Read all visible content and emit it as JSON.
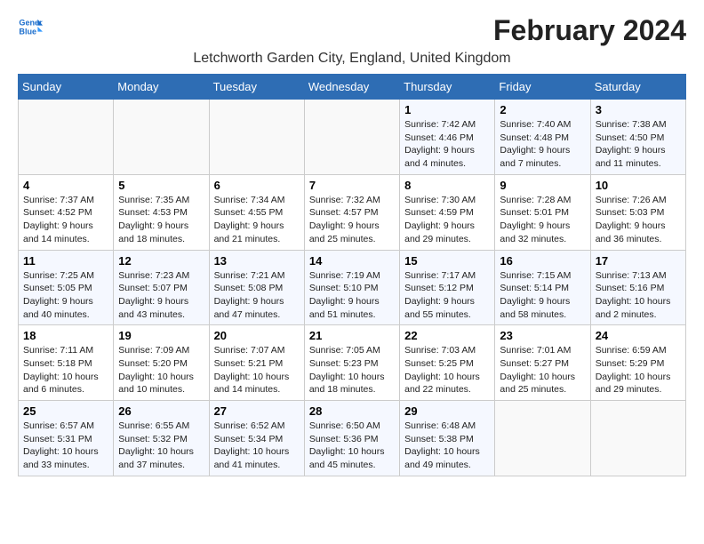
{
  "header": {
    "logo_line1": "General",
    "logo_line2": "Blue",
    "month_year": "February 2024",
    "location": "Letchworth Garden City, England, United Kingdom"
  },
  "days_of_week": [
    "Sunday",
    "Monday",
    "Tuesday",
    "Wednesday",
    "Thursday",
    "Friday",
    "Saturday"
  ],
  "weeks": [
    [
      {
        "day": "",
        "info": ""
      },
      {
        "day": "",
        "info": ""
      },
      {
        "day": "",
        "info": ""
      },
      {
        "day": "",
        "info": ""
      },
      {
        "day": "1",
        "info": "Sunrise: 7:42 AM\nSunset: 4:46 PM\nDaylight: 9 hours\nand 4 minutes."
      },
      {
        "day": "2",
        "info": "Sunrise: 7:40 AM\nSunset: 4:48 PM\nDaylight: 9 hours\nand 7 minutes."
      },
      {
        "day": "3",
        "info": "Sunrise: 7:38 AM\nSunset: 4:50 PM\nDaylight: 9 hours\nand 11 minutes."
      }
    ],
    [
      {
        "day": "4",
        "info": "Sunrise: 7:37 AM\nSunset: 4:52 PM\nDaylight: 9 hours\nand 14 minutes."
      },
      {
        "day": "5",
        "info": "Sunrise: 7:35 AM\nSunset: 4:53 PM\nDaylight: 9 hours\nand 18 minutes."
      },
      {
        "day": "6",
        "info": "Sunrise: 7:34 AM\nSunset: 4:55 PM\nDaylight: 9 hours\nand 21 minutes."
      },
      {
        "day": "7",
        "info": "Sunrise: 7:32 AM\nSunset: 4:57 PM\nDaylight: 9 hours\nand 25 minutes."
      },
      {
        "day": "8",
        "info": "Sunrise: 7:30 AM\nSunset: 4:59 PM\nDaylight: 9 hours\nand 29 minutes."
      },
      {
        "day": "9",
        "info": "Sunrise: 7:28 AM\nSunset: 5:01 PM\nDaylight: 9 hours\nand 32 minutes."
      },
      {
        "day": "10",
        "info": "Sunrise: 7:26 AM\nSunset: 5:03 PM\nDaylight: 9 hours\nand 36 minutes."
      }
    ],
    [
      {
        "day": "11",
        "info": "Sunrise: 7:25 AM\nSunset: 5:05 PM\nDaylight: 9 hours\nand 40 minutes."
      },
      {
        "day": "12",
        "info": "Sunrise: 7:23 AM\nSunset: 5:07 PM\nDaylight: 9 hours\nand 43 minutes."
      },
      {
        "day": "13",
        "info": "Sunrise: 7:21 AM\nSunset: 5:08 PM\nDaylight: 9 hours\nand 47 minutes."
      },
      {
        "day": "14",
        "info": "Sunrise: 7:19 AM\nSunset: 5:10 PM\nDaylight: 9 hours\nand 51 minutes."
      },
      {
        "day": "15",
        "info": "Sunrise: 7:17 AM\nSunset: 5:12 PM\nDaylight: 9 hours\nand 55 minutes."
      },
      {
        "day": "16",
        "info": "Sunrise: 7:15 AM\nSunset: 5:14 PM\nDaylight: 9 hours\nand 58 minutes."
      },
      {
        "day": "17",
        "info": "Sunrise: 7:13 AM\nSunset: 5:16 PM\nDaylight: 10 hours\nand 2 minutes."
      }
    ],
    [
      {
        "day": "18",
        "info": "Sunrise: 7:11 AM\nSunset: 5:18 PM\nDaylight: 10 hours\nand 6 minutes."
      },
      {
        "day": "19",
        "info": "Sunrise: 7:09 AM\nSunset: 5:20 PM\nDaylight: 10 hours\nand 10 minutes."
      },
      {
        "day": "20",
        "info": "Sunrise: 7:07 AM\nSunset: 5:21 PM\nDaylight: 10 hours\nand 14 minutes."
      },
      {
        "day": "21",
        "info": "Sunrise: 7:05 AM\nSunset: 5:23 PM\nDaylight: 10 hours\nand 18 minutes."
      },
      {
        "day": "22",
        "info": "Sunrise: 7:03 AM\nSunset: 5:25 PM\nDaylight: 10 hours\nand 22 minutes."
      },
      {
        "day": "23",
        "info": "Sunrise: 7:01 AM\nSunset: 5:27 PM\nDaylight: 10 hours\nand 25 minutes."
      },
      {
        "day": "24",
        "info": "Sunrise: 6:59 AM\nSunset: 5:29 PM\nDaylight: 10 hours\nand 29 minutes."
      }
    ],
    [
      {
        "day": "25",
        "info": "Sunrise: 6:57 AM\nSunset: 5:31 PM\nDaylight: 10 hours\nand 33 minutes."
      },
      {
        "day": "26",
        "info": "Sunrise: 6:55 AM\nSunset: 5:32 PM\nDaylight: 10 hours\nand 37 minutes."
      },
      {
        "day": "27",
        "info": "Sunrise: 6:52 AM\nSunset: 5:34 PM\nDaylight: 10 hours\nand 41 minutes."
      },
      {
        "day": "28",
        "info": "Sunrise: 6:50 AM\nSunset: 5:36 PM\nDaylight: 10 hours\nand 45 minutes."
      },
      {
        "day": "29",
        "info": "Sunrise: 6:48 AM\nSunset: 5:38 PM\nDaylight: 10 hours\nand 49 minutes."
      },
      {
        "day": "",
        "info": ""
      },
      {
        "day": "",
        "info": ""
      }
    ]
  ]
}
